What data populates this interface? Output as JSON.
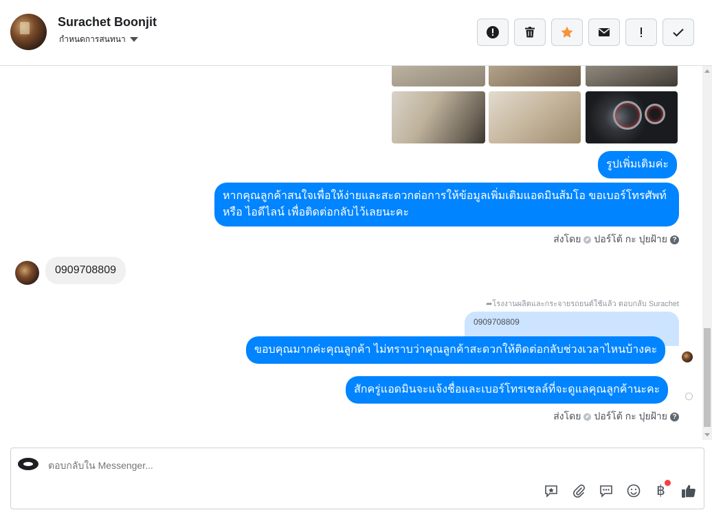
{
  "header": {
    "contact_name": "Surachet Boonjit",
    "assign_label": "กำหนดการสนทนา",
    "actions": [
      {
        "icon": "alert-circle-icon"
      },
      {
        "icon": "trash-icon"
      },
      {
        "icon": "star-icon",
        "color": "#f7923b"
      },
      {
        "icon": "envelope-icon"
      },
      {
        "icon": "exclamation-icon"
      },
      {
        "icon": "checkmark-icon"
      }
    ]
  },
  "messages": {
    "more_photos": "รูปเพิ่มเติมค่ะ",
    "ask_contact": "หากคุณลูกค้าสนใจเพื่อให้ง่ายและสะดวกต่อการให้ข้อมูลเพิ่มเติมแอดมินส้มโอ ขอเบอร์โทรศัพท์ หรือ ไอดีไลน์ เพื่อติดต่อกลับไว้เลยนะคะ",
    "sent_by_prefix": "ส่งโดย",
    "sent_by_name": "ปอร์โต้ กะ ปุยฝ้าย",
    "incoming_phone": "0909708809",
    "replied_note": "โรงงานผลิตและกระจายรถยนต์ใช้แล้ว ตอบกลับ Surachet",
    "quoted_text": "0909708809",
    "thanks": "ขอบคุณมากค่ะคุณลูกค้า ไม่ทราบว่าคุณลูกค้าสะดวกให้ติดต่อกลับช่วงเวลาไหนบ้างคะ",
    "closing": "สักครู่แอดมินจะแจ้งชื่อและเบอร์โทรเซลล์ที่จะดูแลคุณลูกค้านะคะ",
    "sent_by_prefix_2": "ส่งโดย",
    "sent_by_name_2": "ปอร์โต้ กะ ปุยฝ้าย"
  },
  "composer": {
    "placeholder": "ตอบกลับใน Messenger...",
    "tools": [
      "saved-reply-icon",
      "paperclip-icon",
      "quick-reply-icon",
      "emoji-icon",
      "payment-baht-icon",
      "like-icon"
    ],
    "baht_symbol": "฿"
  },
  "colors": {
    "bubble_out": "#0084ff",
    "bubble_in": "#f1f0f0",
    "quote": "#cce4ff",
    "star": "#f7923b",
    "notification": "#fa3e3e"
  }
}
